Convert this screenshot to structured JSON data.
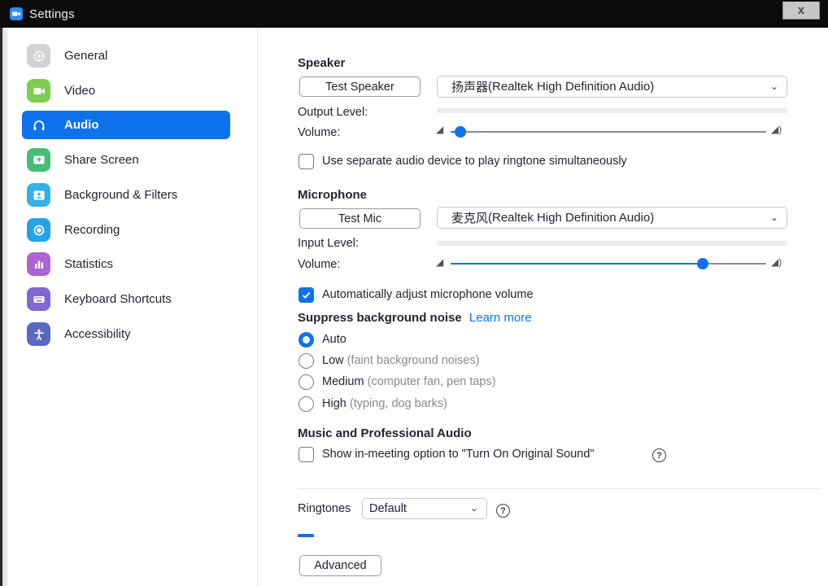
{
  "window": {
    "title": "Settings",
    "close_glyph": "x"
  },
  "sidebar": {
    "items": [
      {
        "label": "General",
        "icon": "gear-icon",
        "color": "#cfcfcf"
      },
      {
        "label": "Video",
        "icon": "video-camera-icon",
        "color": "#73c84a"
      },
      {
        "label": "Audio",
        "icon": "headphones-icon",
        "color": "#0e72ed",
        "active": true
      },
      {
        "label": "Share Screen",
        "icon": "share-screen-icon",
        "color": "#3fb970"
      },
      {
        "label": "Background & Filters",
        "icon": "background-icon",
        "color": "#2eaee4"
      },
      {
        "label": "Recording",
        "icon": "recording-icon",
        "color": "#1e9ee6"
      },
      {
        "label": "Statistics",
        "icon": "statistics-icon",
        "color": "#a35ccc"
      },
      {
        "label": "Keyboard Shortcuts",
        "icon": "keyboard-icon",
        "color": "#7c63cf"
      },
      {
        "label": "Accessibility",
        "icon": "accessibility-icon",
        "color": "#5263b8"
      }
    ]
  },
  "speaker": {
    "title": "Speaker",
    "test_button": "Test Speaker",
    "device_prefix": "扬声器",
    "device": " (Realtek High Definition Audio)",
    "output_level_label": "Output Level:",
    "output_level": 0,
    "volume_label": "Volume:",
    "volume": 0.03
  },
  "ringtone_option": {
    "label": "Use separate audio device to play ringtone simultaneously",
    "checked": false
  },
  "microphone": {
    "title": "Microphone",
    "test_button": "Test Mic",
    "device_prefix": "麦克风",
    "device": " (Realtek High Definition Audio)",
    "input_level_label": "Input Level:",
    "input_level": 0,
    "volume_label": "Volume:",
    "volume": 0.8
  },
  "auto_adjust": {
    "label": "Automatically adjust microphone volume",
    "checked": true
  },
  "suppress": {
    "title": "Suppress background noise",
    "learn_more": "Learn more",
    "selected": "Auto",
    "options": [
      {
        "label": "Auto",
        "hint": ""
      },
      {
        "label": "Low",
        "hint": "(faint background noises)"
      },
      {
        "label": "Medium",
        "hint": "(computer fan, pen taps)"
      },
      {
        "label": "High",
        "hint": "(typing, dog barks)"
      }
    ]
  },
  "music": {
    "title": "Music and Professional Audio",
    "original_sound_label": "Show in-meeting option to \"Turn On Original Sound\"",
    "checked": false
  },
  "ringtones": {
    "label": "Ringtones",
    "value": "Default"
  },
  "advanced_button": "Advanced"
}
